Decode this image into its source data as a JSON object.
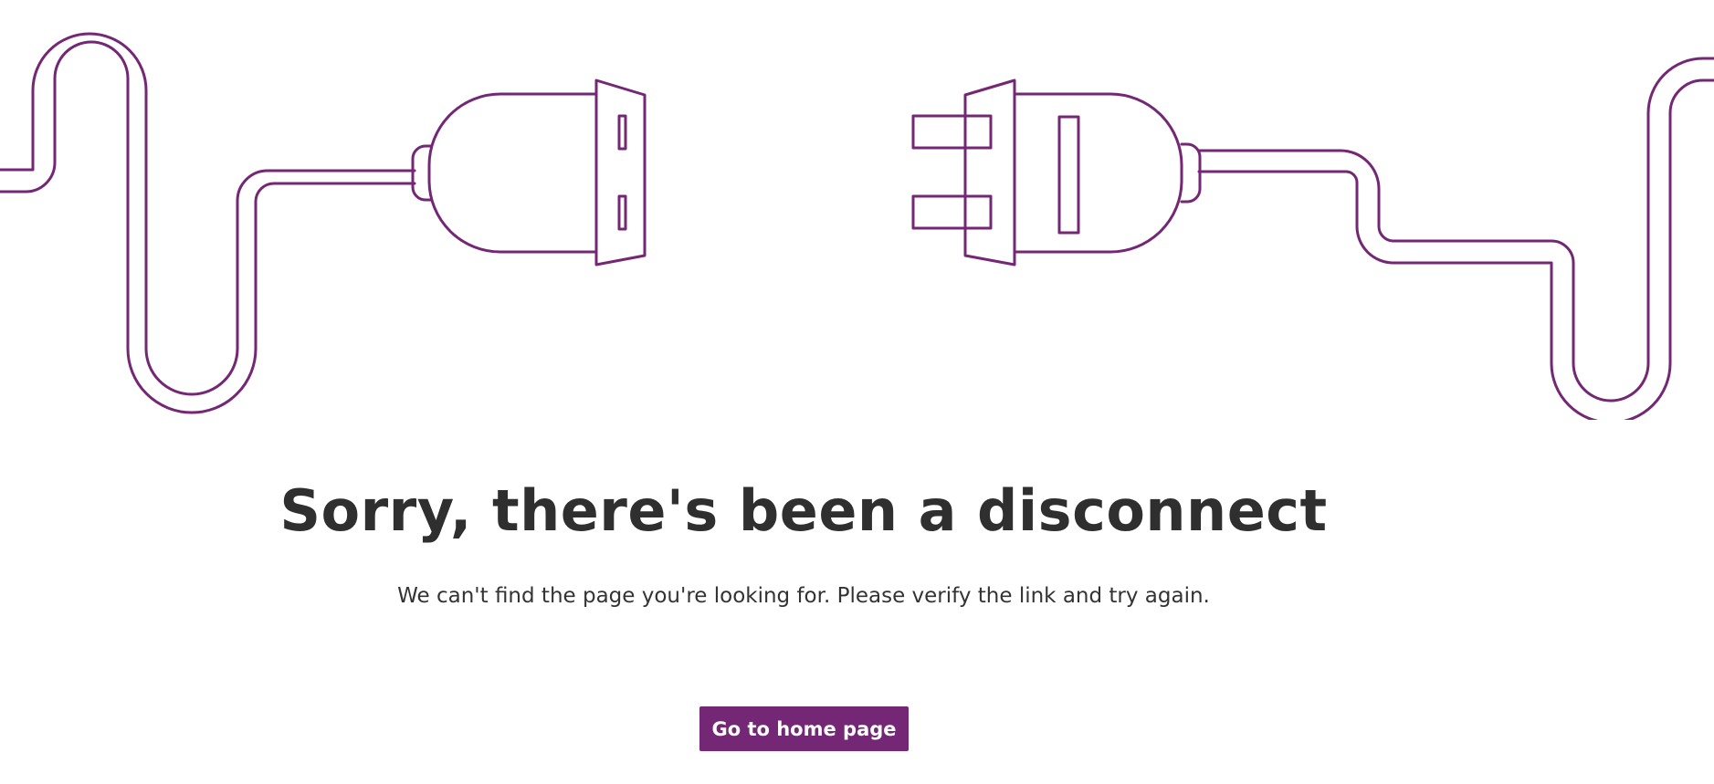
{
  "illustration": {
    "icon": "unplugged-cable-illustration",
    "stroke_color": "#742774"
  },
  "error": {
    "headline": "Sorry, there's been a disconnect",
    "message": "We can't find the page you're looking for. Please verify the link and try again."
  },
  "actions": {
    "home_label": "Go to home page",
    "accent_color": "#742774"
  }
}
